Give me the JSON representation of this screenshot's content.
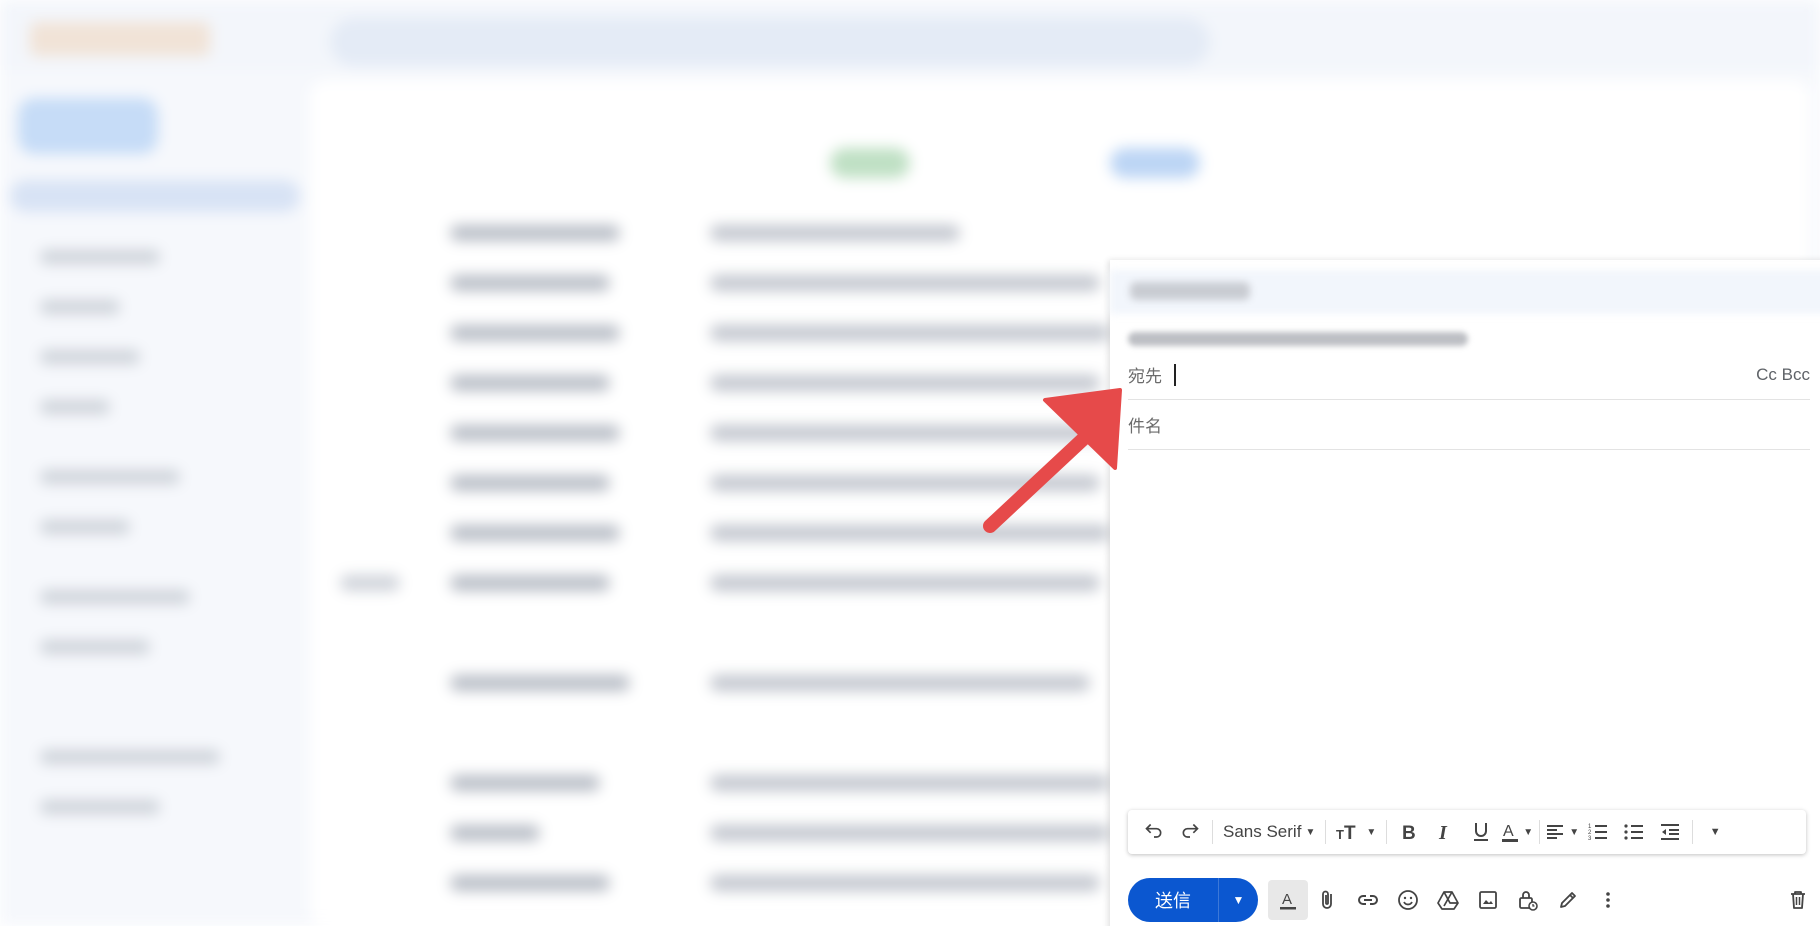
{
  "compose": {
    "to_label": "宛先",
    "cc_bcc_label": "Cc Bcc",
    "subject_placeholder": "件名",
    "send_label": "送信"
  },
  "toolbar": {
    "font_name": "Sans Serif",
    "icons": [
      "undo-icon",
      "redo-icon",
      "text-size-icon",
      "bold-icon",
      "italic-icon",
      "underline-icon",
      "text-color-icon",
      "align-icon",
      "numbered-list-icon",
      "bulleted-list-icon",
      "indent-less-icon",
      "more-formatting-icon"
    ]
  },
  "bottom_bar": {
    "icons": [
      "formatting-options-icon",
      "attach-icon",
      "link-icon",
      "emoji-icon",
      "drive-icon",
      "photo-icon",
      "confidential-icon",
      "signature-icon",
      "more-options-icon",
      "trash-icon"
    ]
  },
  "colors": {
    "send_blue": "#0b57d0",
    "arrow_red": "#e64a4a"
  }
}
